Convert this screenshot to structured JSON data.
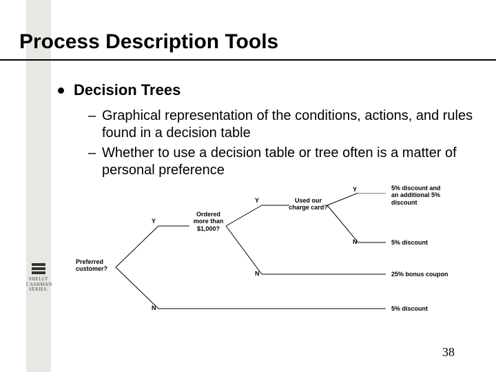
{
  "title": "Process Description Tools",
  "bullet": "Decision Trees",
  "sub_items": [
    "Graphical representation of the conditions, actions, and rules found in a decision table",
    "Whether to use a decision table or tree often is a matter of personal preference"
  ],
  "page_number": "38",
  "logo": {
    "line1": "SHELLY",
    "line2": "CASHMAN",
    "line3": "SERIES."
  },
  "diagram": {
    "root_label": "Preferred\ncustomer?",
    "q2_label": "Ordered\nmore than\n$1,000?",
    "q3_label": "Used our\ncharge card?",
    "yes": "Y",
    "no": "N",
    "leaf1": "5% discount and\nan additional 5%\ndiscount",
    "leaf2": "5% discount",
    "leaf3": "25% bonus coupon",
    "leaf4": "5% discount"
  }
}
